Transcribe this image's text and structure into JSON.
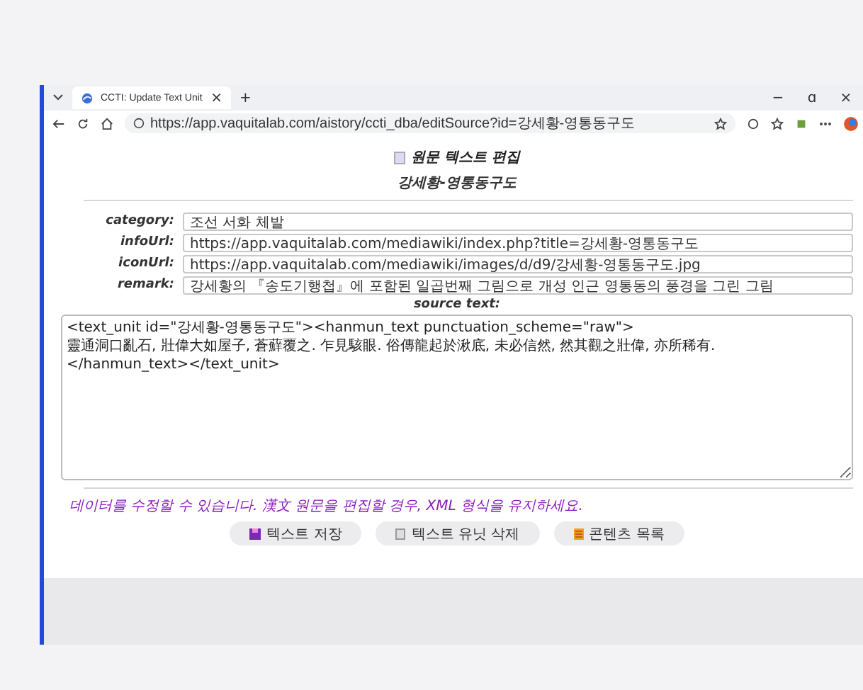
{
  "browser": {
    "tab_title": "CCTI: Update Text Unit",
    "tab_close": "×",
    "new_tab": "+",
    "minimize": "−",
    "restore": "ɑ",
    "close": "×",
    "url": "https://app.vaquitalab.com/aistory/ccti_dba/editSource?id=강세황-영통동구도"
  },
  "page": {
    "title": "원문 텍스트 편집",
    "subtitle": "강세황-영통동구도",
    "fields": [
      {
        "label": "category:",
        "value": "조선 서화 체발"
      },
      {
        "label": "infoUrl:",
        "value": "https://app.vaquitalab.com/mediawiki/index.php?title=강세황-영통동구도"
      },
      {
        "label": "iconUrl:",
        "value": "https://app.vaquitalab.com/mediawiki/images/d/d9/강세황-영통동구도.jpg"
      },
      {
        "label": "remark:",
        "value": "강세황의 『송도기행첩』에 포함된 일곱번째 그림으로 개성 인근 영통동의 풍경을 그린 그림"
      }
    ],
    "source_label": "source text:",
    "source_text": "<text_unit id=\"강세황-영통동구도\"><hanmun_text punctuation_scheme=\"raw\">\n靈通洞口亂石, 壯偉大如屋子, 蒼蘚覆之. 乍見駭眼. 俗傳龍起於湫底, 未必信然, 然其觀之壯偉, 亦所稀有.\n</hanmun_text></text_unit>",
    "note": "데이터를 수정할 수 있습니다. 漢文 원문을 편집할 경우, XML 형식을 유지하세요.",
    "buttons": [
      {
        "kind": "save",
        "label": "텍스트 저장"
      },
      {
        "kind": "delete",
        "label": "텍스트 유닛 삭제"
      },
      {
        "kind": "list",
        "label": "콘텐츠 목록"
      }
    ]
  }
}
